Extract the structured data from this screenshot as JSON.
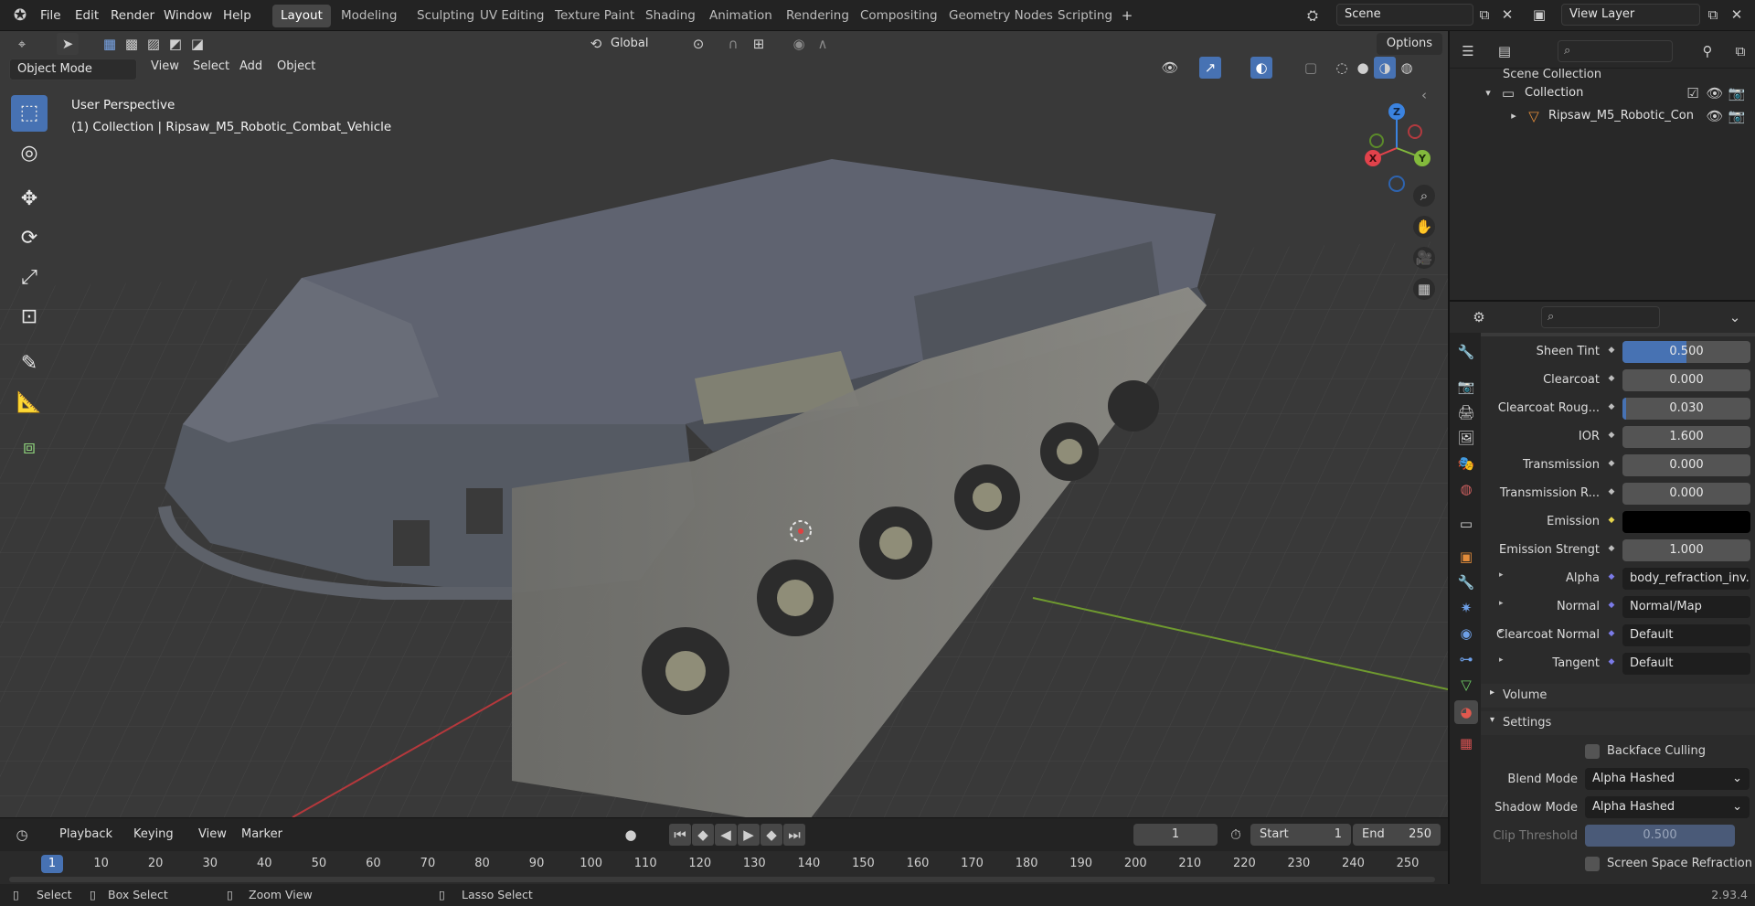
{
  "app": {
    "menus": [
      "File",
      "Edit",
      "Render",
      "Window",
      "Help"
    ],
    "workspaces": [
      "Layout",
      "Modeling",
      "Sculpting",
      "UV Editing",
      "Texture Paint",
      "Shading",
      "Animation",
      "Rendering",
      "Compositing",
      "Geometry Nodes",
      "Scripting"
    ],
    "active_workspace": "Layout",
    "scene": "Scene",
    "view_layer": "View Layer"
  },
  "viewport": {
    "mode": "Object Mode",
    "header_menus": [
      "View",
      "Select",
      "Add",
      "Object"
    ],
    "transform_orientation": "Global",
    "options_label": "Options",
    "perspective": "User Perspective",
    "collection_info": "(1) Collection | Ripsaw_M5_Robotic_Combat_Vehicle",
    "gizmo": {
      "z": "Z",
      "y": "Y",
      "x": "X"
    }
  },
  "outliner": {
    "root": "Scene Collection",
    "collection": "Collection",
    "object": "Ripsaw_M5_Robotic_Con"
  },
  "properties": {
    "rows": [
      {
        "label": "Sheen Tint",
        "value": "0.500",
        "type": "slider",
        "fill": 0.5
      },
      {
        "label": "Clearcoat",
        "value": "0.000",
        "type": "slider",
        "fill": 0
      },
      {
        "label": "Clearcoat Roug...",
        "value": "0.030",
        "type": "slider",
        "fill": 0.03
      },
      {
        "label": "IOR",
        "value": "1.600",
        "type": "number"
      },
      {
        "label": "Transmission",
        "value": "0.000",
        "type": "slider",
        "fill": 0
      },
      {
        "label": "Transmission R...",
        "value": "0.000",
        "type": "slider",
        "fill": 0
      },
      {
        "label": "Emission",
        "value": "",
        "type": "color",
        "color": "#000000"
      },
      {
        "label": "Emission Strengt",
        "value": "1.000",
        "type": "number"
      },
      {
        "label": "Alpha",
        "value": "body_refraction_inv...",
        "type": "link"
      },
      {
        "label": "Normal",
        "value": "Normal/Map",
        "type": "link"
      },
      {
        "label": "Clearcoat Normal",
        "value": "Default",
        "type": "link"
      },
      {
        "label": "Tangent",
        "value": "Default",
        "type": "link"
      }
    ],
    "volume_label": "Volume",
    "settings_label": "Settings",
    "backface_culling": "Backface Culling",
    "blend_mode_label": "Blend Mode",
    "blend_mode": "Alpha Hashed",
    "shadow_mode_label": "Shadow Mode",
    "shadow_mode": "Alpha Hashed",
    "clip_threshold_label": "Clip Threshold",
    "clip_threshold": "0.500",
    "screen_space_refraction": "Screen Space Refraction"
  },
  "timeline": {
    "menus": [
      "Playback",
      "Keying",
      "View",
      "Marker"
    ],
    "current_frame": "1",
    "start_label": "Start",
    "start": "1",
    "end_label": "End",
    "end": "250",
    "ticks": [
      "1",
      "10",
      "20",
      "30",
      "40",
      "50",
      "60",
      "70",
      "80",
      "90",
      "100",
      "110",
      "120",
      "130",
      "140",
      "150",
      "160",
      "170",
      "180",
      "190",
      "200",
      "210",
      "220",
      "230",
      "240",
      "250"
    ]
  },
  "status": {
    "select": "Select",
    "box_select": "Box Select",
    "zoom_view": "Zoom View",
    "lasso_select": "Lasso Select",
    "version": "2.93.4"
  },
  "colors": {
    "accent": "#4772b3",
    "x_axis": "#e2424b",
    "y_axis": "#83ba3c",
    "z_axis": "#3b83e0"
  }
}
